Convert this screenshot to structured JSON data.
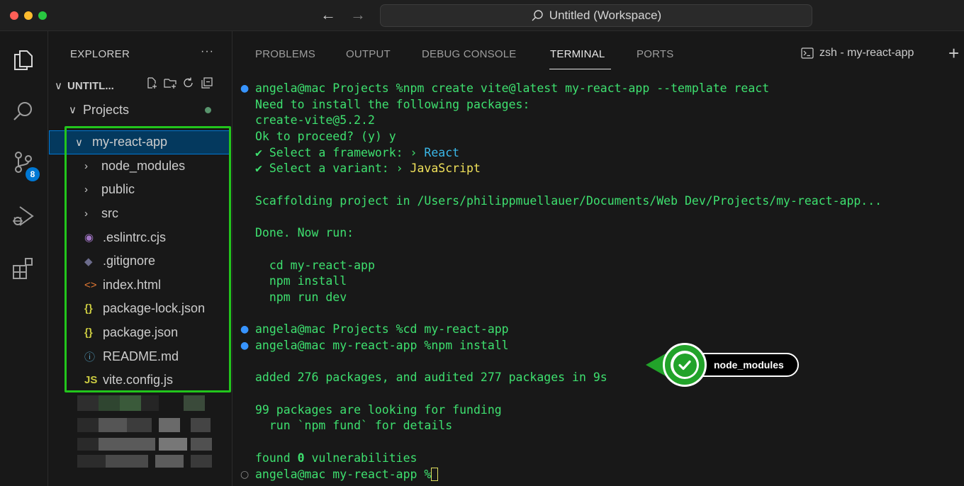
{
  "window": {
    "search_text": "Untitled (Workspace)",
    "back_arrow": "←",
    "forward_arrow": "→"
  },
  "activity_bar": {
    "items": [
      "explorer-icon",
      "search-icon",
      "source-control-icon",
      "run-debug-icon",
      "extensions-icon"
    ],
    "source_control_badge": "8"
  },
  "sidebar": {
    "title": "EXPLORER",
    "more": "···",
    "workspace_label": "UNTITL...",
    "projects_label": "Projects",
    "tree": [
      {
        "label": "my-react-app",
        "chevron": "∨",
        "icon": "",
        "icon_color": "",
        "selected": true,
        "indent": 1
      },
      {
        "label": "node_modules",
        "chevron": "›",
        "icon": "",
        "icon_color": "",
        "selected": false,
        "indent": 2
      },
      {
        "label": "public",
        "chevron": "›",
        "icon": "",
        "icon_color": "",
        "selected": false,
        "indent": 2
      },
      {
        "label": "src",
        "chevron": "›",
        "icon": "",
        "icon_color": "",
        "selected": false,
        "indent": 2
      },
      {
        "label": ".eslintrc.cjs",
        "chevron": "",
        "icon": "◉",
        "icon_color": "#a074c4",
        "selected": false,
        "indent": 2
      },
      {
        "label": ".gitignore",
        "chevron": "",
        "icon": "◆",
        "icon_color": "#6c6c8c",
        "selected": false,
        "indent": 2
      },
      {
        "label": "index.html",
        "chevron": "",
        "icon": "<>",
        "icon_color": "#e37933",
        "selected": false,
        "indent": 2
      },
      {
        "label": "package-lock.json",
        "chevron": "",
        "icon": "{}",
        "icon_color": "#cbcb41",
        "selected": false,
        "indent": 2
      },
      {
        "label": "package.json",
        "chevron": "",
        "icon": "{}",
        "icon_color": "#cbcb41",
        "selected": false,
        "indent": 2
      },
      {
        "label": "README.md",
        "chevron": "",
        "icon": "ⓘ",
        "icon_color": "#519aba",
        "selected": false,
        "indent": 2
      },
      {
        "label": "vite.config.js",
        "chevron": "",
        "icon": "JS",
        "icon_color": "#cbcb41",
        "selected": false,
        "indent": 2
      }
    ]
  },
  "panel": {
    "tabs": [
      "PROBLEMS",
      "OUTPUT",
      "DEBUG CONSOLE",
      "TERMINAL",
      "PORTS"
    ],
    "active_tab": "TERMINAL",
    "terminal_name": "zsh - my-react-app",
    "add_terminal": "+"
  },
  "terminal": {
    "lines": [
      {
        "mark": "●",
        "segments": [
          {
            "t": "angela@mac Projects %npm create vite@latest my-react-app --template react",
            "c": "cmd"
          }
        ]
      },
      {
        "mark": "",
        "segments": [
          {
            "t": "Need to install the following packages:",
            "c": "cmd"
          }
        ]
      },
      {
        "mark": "",
        "segments": [
          {
            "t": "create-vite@5.2.2",
            "c": "cmd"
          }
        ]
      },
      {
        "mark": "",
        "segments": [
          {
            "t": "Ok to proceed? (y) y",
            "c": "cmd"
          }
        ]
      },
      {
        "mark": "",
        "segments": [
          {
            "t": "✔ Select a framework: › ",
            "c": "cmd"
          },
          {
            "t": "React",
            "c": "react"
          }
        ]
      },
      {
        "mark": "",
        "segments": [
          {
            "t": "✔ Select a variant: › ",
            "c": "cmd"
          },
          {
            "t": "JavaScript",
            "c": "js"
          }
        ]
      },
      {
        "mark": "",
        "segments": [
          {
            "t": "",
            "c": "cmd"
          }
        ]
      },
      {
        "mark": "",
        "segments": [
          {
            "t": "Scaffolding project in /Users/philippmuellauer/Documents/Web Dev/Projects/my-react-app...",
            "c": "cmd"
          }
        ]
      },
      {
        "mark": "",
        "segments": [
          {
            "t": "",
            "c": "cmd"
          }
        ]
      },
      {
        "mark": "",
        "segments": [
          {
            "t": "Done. Now run:",
            "c": "cmd"
          }
        ]
      },
      {
        "mark": "",
        "segments": [
          {
            "t": "",
            "c": "cmd"
          }
        ]
      },
      {
        "mark": "",
        "segments": [
          {
            "t": "  cd my-react-app",
            "c": "cmd"
          }
        ]
      },
      {
        "mark": "",
        "segments": [
          {
            "t": "  npm install",
            "c": "cmd"
          }
        ]
      },
      {
        "mark": "",
        "segments": [
          {
            "t": "  npm run dev",
            "c": "cmd"
          }
        ]
      },
      {
        "mark": "",
        "segments": [
          {
            "t": "",
            "c": "cmd"
          }
        ]
      },
      {
        "mark": "●",
        "segments": [
          {
            "t": "angela@mac Projects %cd my-react-app",
            "c": "cmd"
          }
        ]
      },
      {
        "mark": "●",
        "segments": [
          {
            "t": "angela@mac my-react-app %npm install",
            "c": "cmd"
          }
        ]
      },
      {
        "mark": "",
        "segments": [
          {
            "t": "",
            "c": "cmd"
          }
        ]
      },
      {
        "mark": "",
        "segments": [
          {
            "t": "added 276 packages, and audited 277 packages in 9s",
            "c": "cmd"
          }
        ]
      },
      {
        "mark": "",
        "segments": [
          {
            "t": "",
            "c": "cmd"
          }
        ]
      },
      {
        "mark": "",
        "segments": [
          {
            "t": "99 packages are looking for funding",
            "c": "cmd"
          }
        ]
      },
      {
        "mark": "",
        "segments": [
          {
            "t": "  run `npm fund` for details",
            "c": "cmd"
          }
        ]
      },
      {
        "mark": "",
        "segments": [
          {
            "t": "",
            "c": "cmd"
          }
        ]
      },
      {
        "mark": "",
        "segments": [
          {
            "t": "found ",
            "c": "cmd"
          },
          {
            "t": "0",
            "c": "bold0"
          },
          {
            "t": " vulnerabilities",
            "c": "cmd"
          }
        ]
      },
      {
        "mark": "○",
        "segments": [
          {
            "t": "angela@mac my-react-app %",
            "c": "cmd"
          }
        ],
        "cursor": true
      }
    ]
  },
  "callout": {
    "label": "node_modules"
  },
  "colors": {
    "accent": "#0078d4",
    "highlight": "#22c51c",
    "terminal_text": "#3ee06f"
  }
}
